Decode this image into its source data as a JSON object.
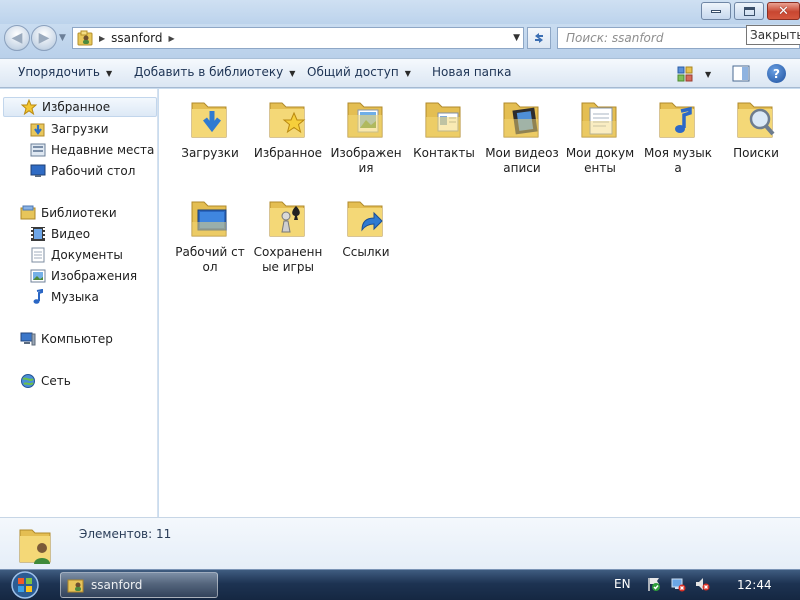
{
  "window": {
    "tooltip": "Закрыть"
  },
  "address": {
    "path": "ssanford",
    "search_placeholder": "Поиск: ssanford"
  },
  "toolbar": {
    "organize": "Упорядочить",
    "add_library": "Добавить в библиотеку",
    "share": "Общий доступ",
    "new_folder": "Новая папка",
    "help": "?"
  },
  "nav": {
    "favorites": "Избранное",
    "downloads": "Загрузки",
    "recent": "Недавние места",
    "desktop": "Рабочий стол",
    "libraries": "Библиотеки",
    "video": "Видео",
    "documents": "Документы",
    "pictures": "Изображения",
    "music": "Музыка",
    "computer": "Компьютер",
    "network": "Сеть"
  },
  "items": [
    {
      "label": "Загрузки",
      "icon": "downloads-folder-icon"
    },
    {
      "label": "Избранное",
      "icon": "favorites-folder-icon"
    },
    {
      "label": "Изображения",
      "icon": "pictures-folder-icon"
    },
    {
      "label": "Контакты",
      "icon": "contacts-folder-icon"
    },
    {
      "label": "Мои видеозаписи",
      "icon": "videos-folder-icon"
    },
    {
      "label": "Мои документы",
      "icon": "documents-folder-icon"
    },
    {
      "label": "Моя музыка",
      "icon": "music-folder-icon"
    },
    {
      "label": "Поиски",
      "icon": "searches-folder-icon"
    },
    {
      "label": "Рабочий стол",
      "icon": "desktop-folder-icon"
    },
    {
      "label": "Сохраненные игры",
      "icon": "saved-games-folder-icon"
    },
    {
      "label": "Ссылки",
      "icon": "links-folder-icon"
    }
  ],
  "details": {
    "count": "Элементов: 11"
  },
  "taskbar": {
    "window_label": "ssanford",
    "lang": "EN",
    "clock": "12:44"
  }
}
